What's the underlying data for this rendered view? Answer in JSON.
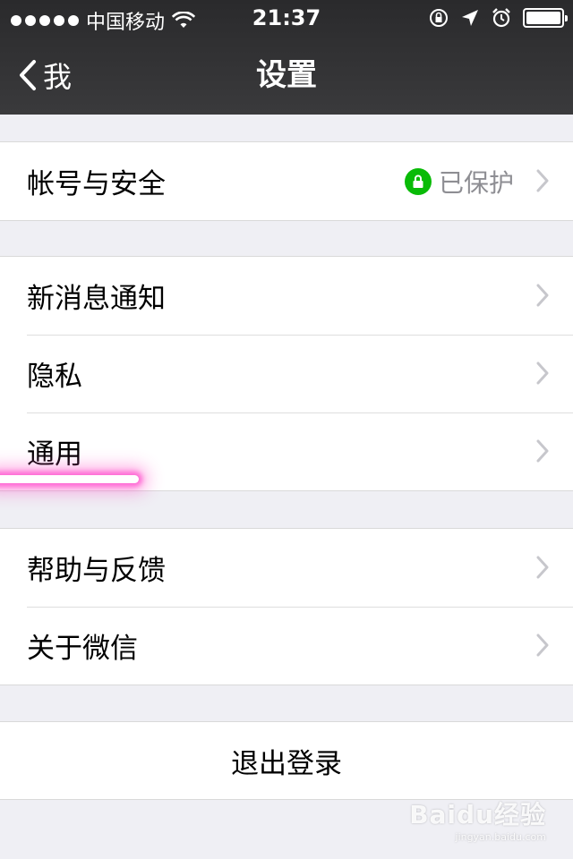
{
  "status_bar": {
    "carrier": "中国移动",
    "time": "21:37"
  },
  "nav": {
    "back_label": "我",
    "title": "设置"
  },
  "groups": [
    {
      "items": [
        {
          "label": "帐号与安全",
          "detail": "已保护",
          "detail_icon": "lock-icon"
        }
      ]
    },
    {
      "items": [
        {
          "label": "新消息通知"
        },
        {
          "label": "隐私"
        },
        {
          "label": "通用"
        }
      ]
    },
    {
      "items": [
        {
          "label": "帮助与反馈"
        },
        {
          "label": "关于微信"
        }
      ]
    }
  ],
  "logout_label": "退出登录",
  "watermark": {
    "brand": "Baidu经验",
    "site": "jingyan.baidu.com"
  },
  "colors": {
    "nav_background": "#2f2f31",
    "page_background": "#efeff4",
    "secure_green": "#09bb07",
    "highlight_pink": "#ff6ad5"
  }
}
